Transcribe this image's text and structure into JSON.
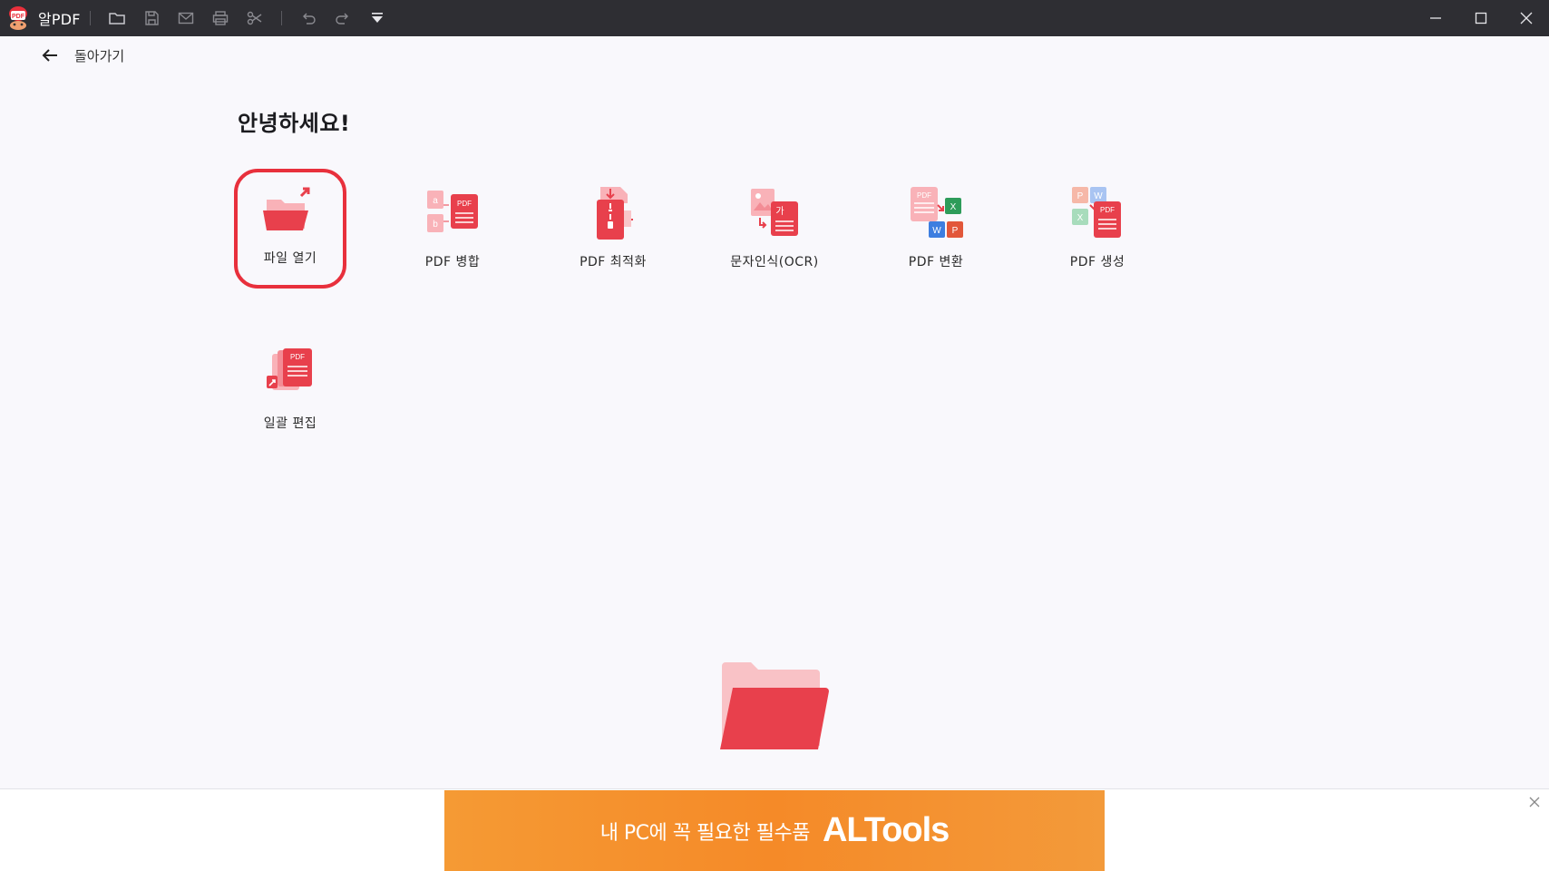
{
  "app": {
    "name": "알PDF"
  },
  "nav": {
    "back_label": "돌아가기"
  },
  "home": {
    "greeting": "안녕하세요!"
  },
  "tools": [
    {
      "label": "파일 열기",
      "icon": "folder-open-icon",
      "selected": true
    },
    {
      "label": "PDF 병합",
      "icon": "pdf-merge-icon"
    },
    {
      "label": "PDF 최적화",
      "icon": "pdf-compress-icon"
    },
    {
      "label": "문자인식(OCR)",
      "icon": "ocr-icon"
    },
    {
      "label": "PDF 변환",
      "icon": "pdf-convert-icon"
    },
    {
      "label": "PDF 생성",
      "icon": "pdf-create-icon"
    },
    {
      "label": "일괄 편집",
      "icon": "batch-edit-icon"
    }
  ],
  "ad": {
    "text": "내 PC에 꼭 필요한 필수품",
    "brand": "ALTools"
  },
  "colors": {
    "accent": "#e8303c",
    "titlebar": "#2e2e33",
    "ad": "#f58a28"
  }
}
